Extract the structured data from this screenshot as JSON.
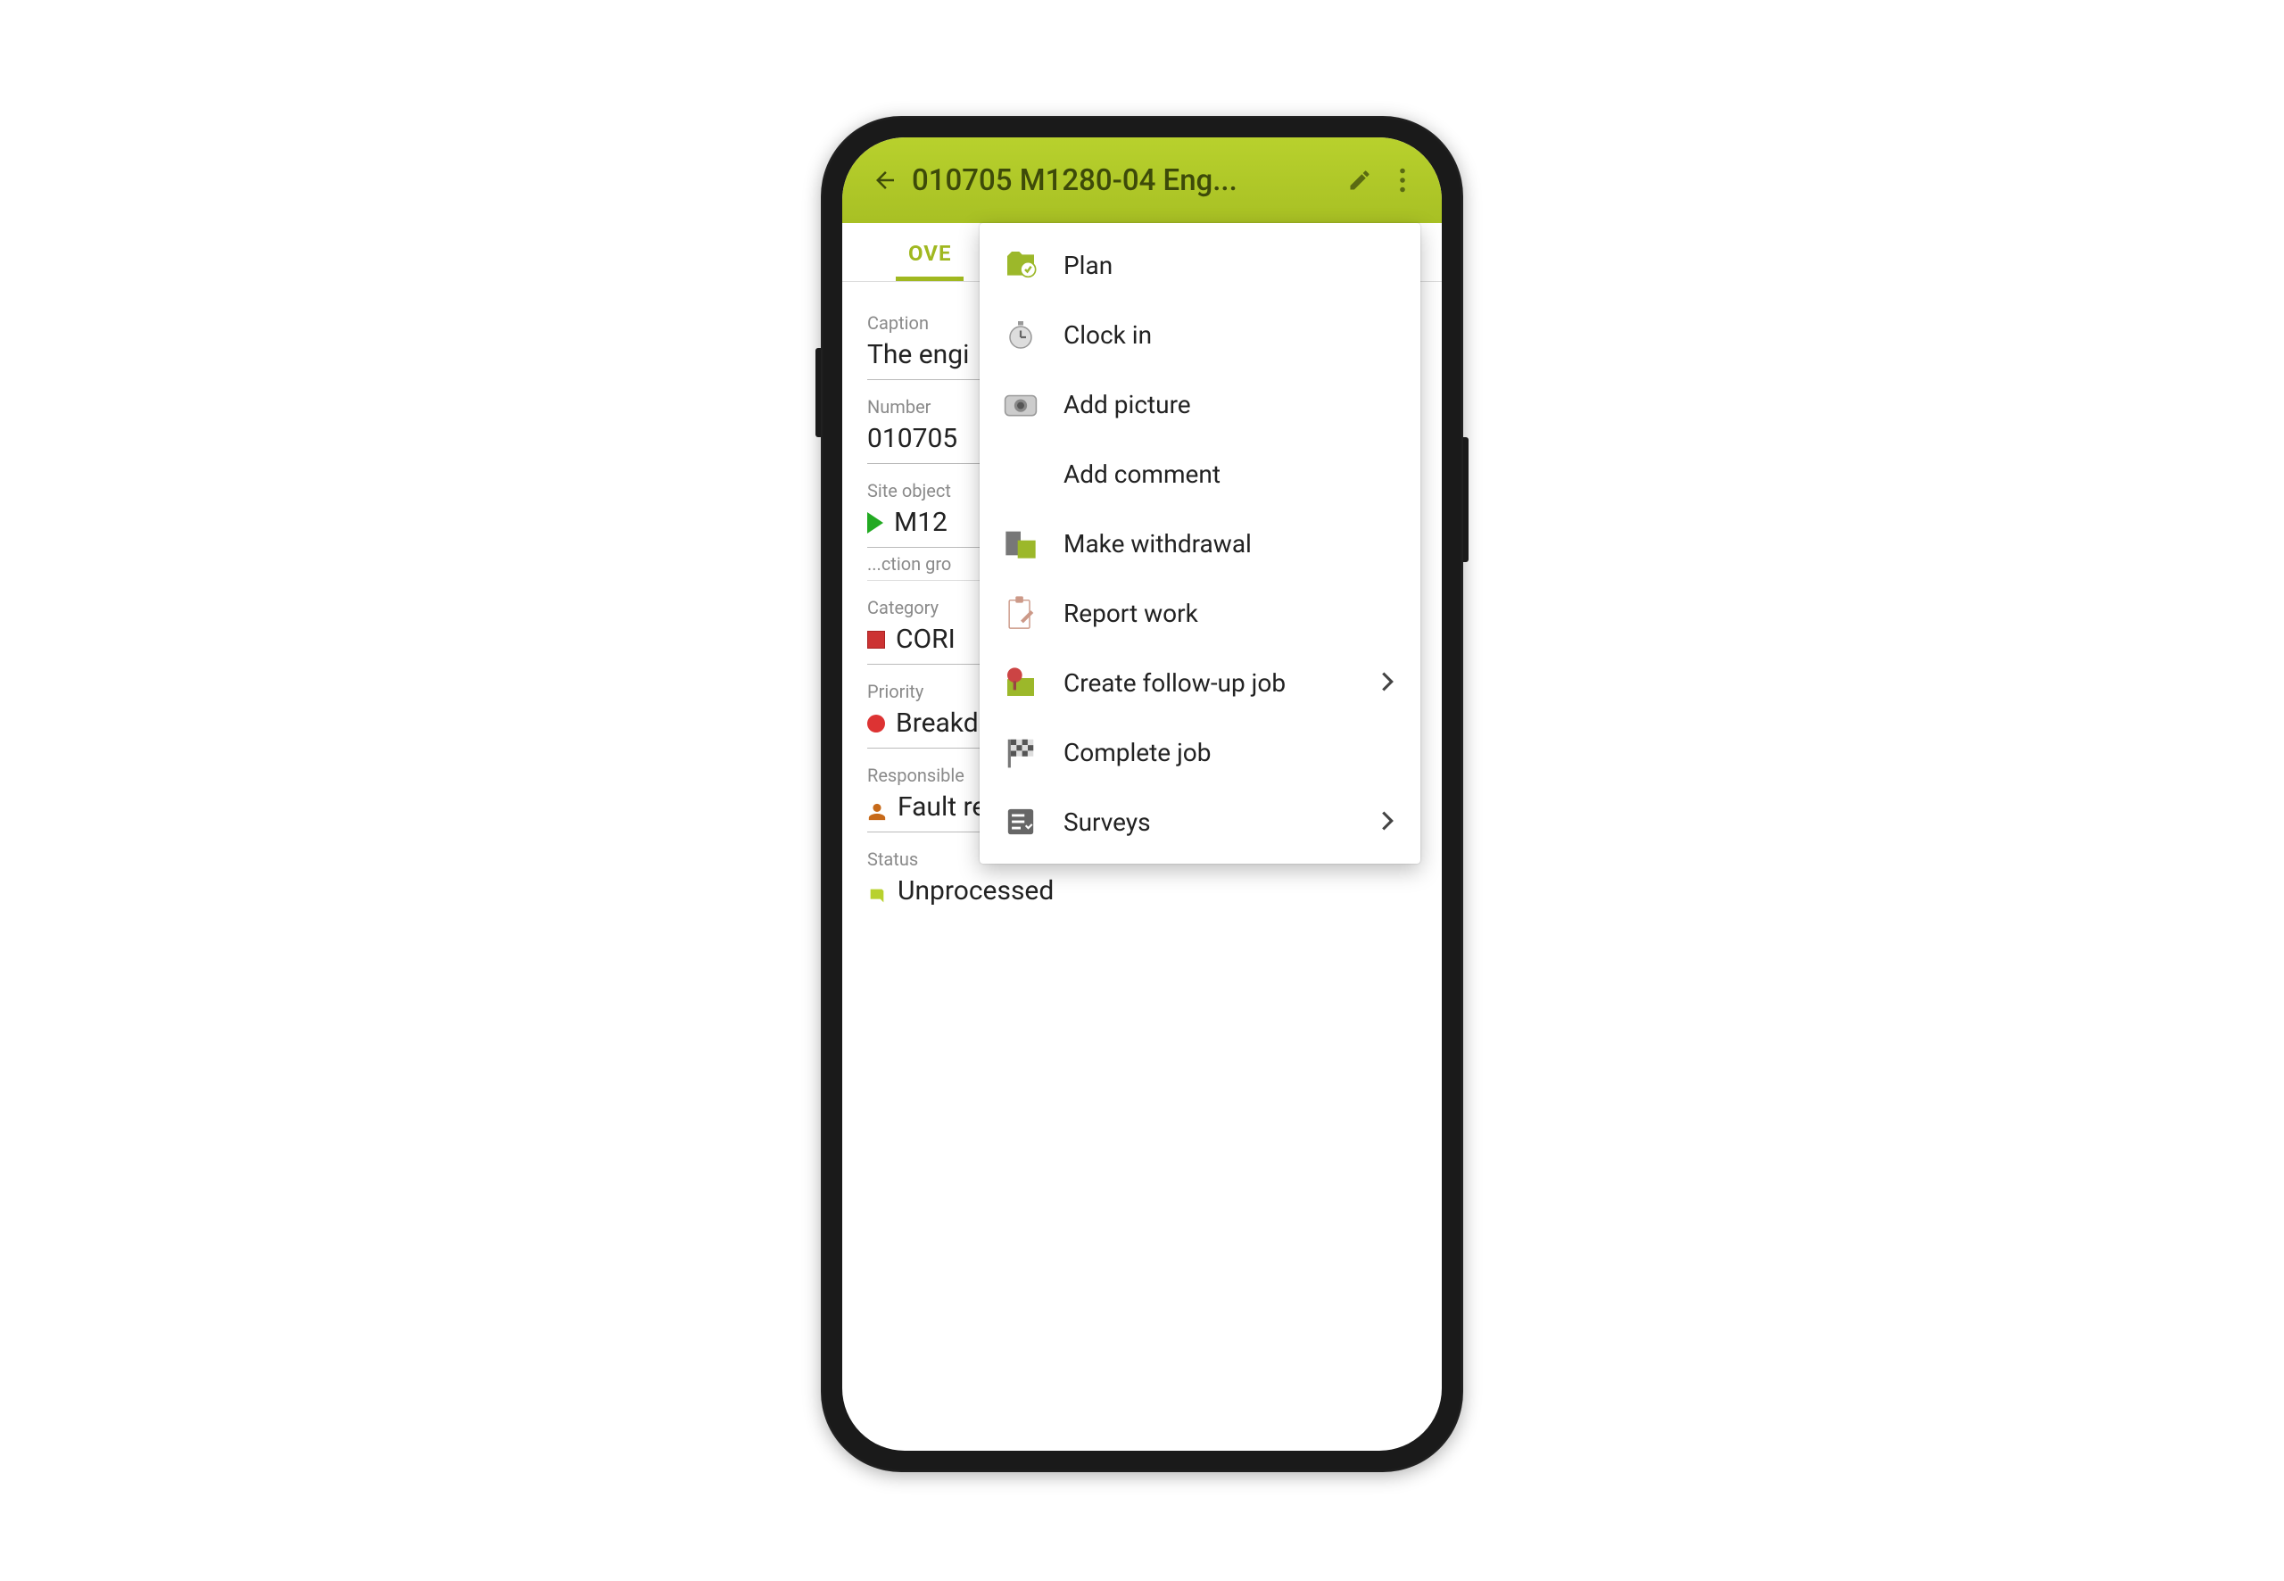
{
  "header": {
    "title": "010705 M1280-04 Eng..."
  },
  "tabs": {
    "active": "OVE"
  },
  "fields": {
    "caption_label": "Caption",
    "caption_value": "The engi",
    "number_label": "Number",
    "number_value": "010705",
    "siteobject_label": "Site object",
    "siteobject_value": "M12",
    "siteobject_sub": "...ction gro",
    "category_label": "Category",
    "category_value": "CORI",
    "priority_label": "Priority",
    "priority_value": "Breakdown",
    "responsible_label": "Responsible",
    "responsible_value": "Fault report",
    "status_label": "Status",
    "status_value": "Unprocessed"
  },
  "menu": {
    "items": [
      {
        "label": "Plan"
      },
      {
        "label": "Clock in"
      },
      {
        "label": "Add picture"
      },
      {
        "label": "Add comment"
      },
      {
        "label": "Make withdrawal"
      },
      {
        "label": "Report work"
      },
      {
        "label": "Create follow-up job",
        "submenu": true
      },
      {
        "label": "Complete job"
      },
      {
        "label": "Surveys",
        "submenu": true
      }
    ]
  }
}
